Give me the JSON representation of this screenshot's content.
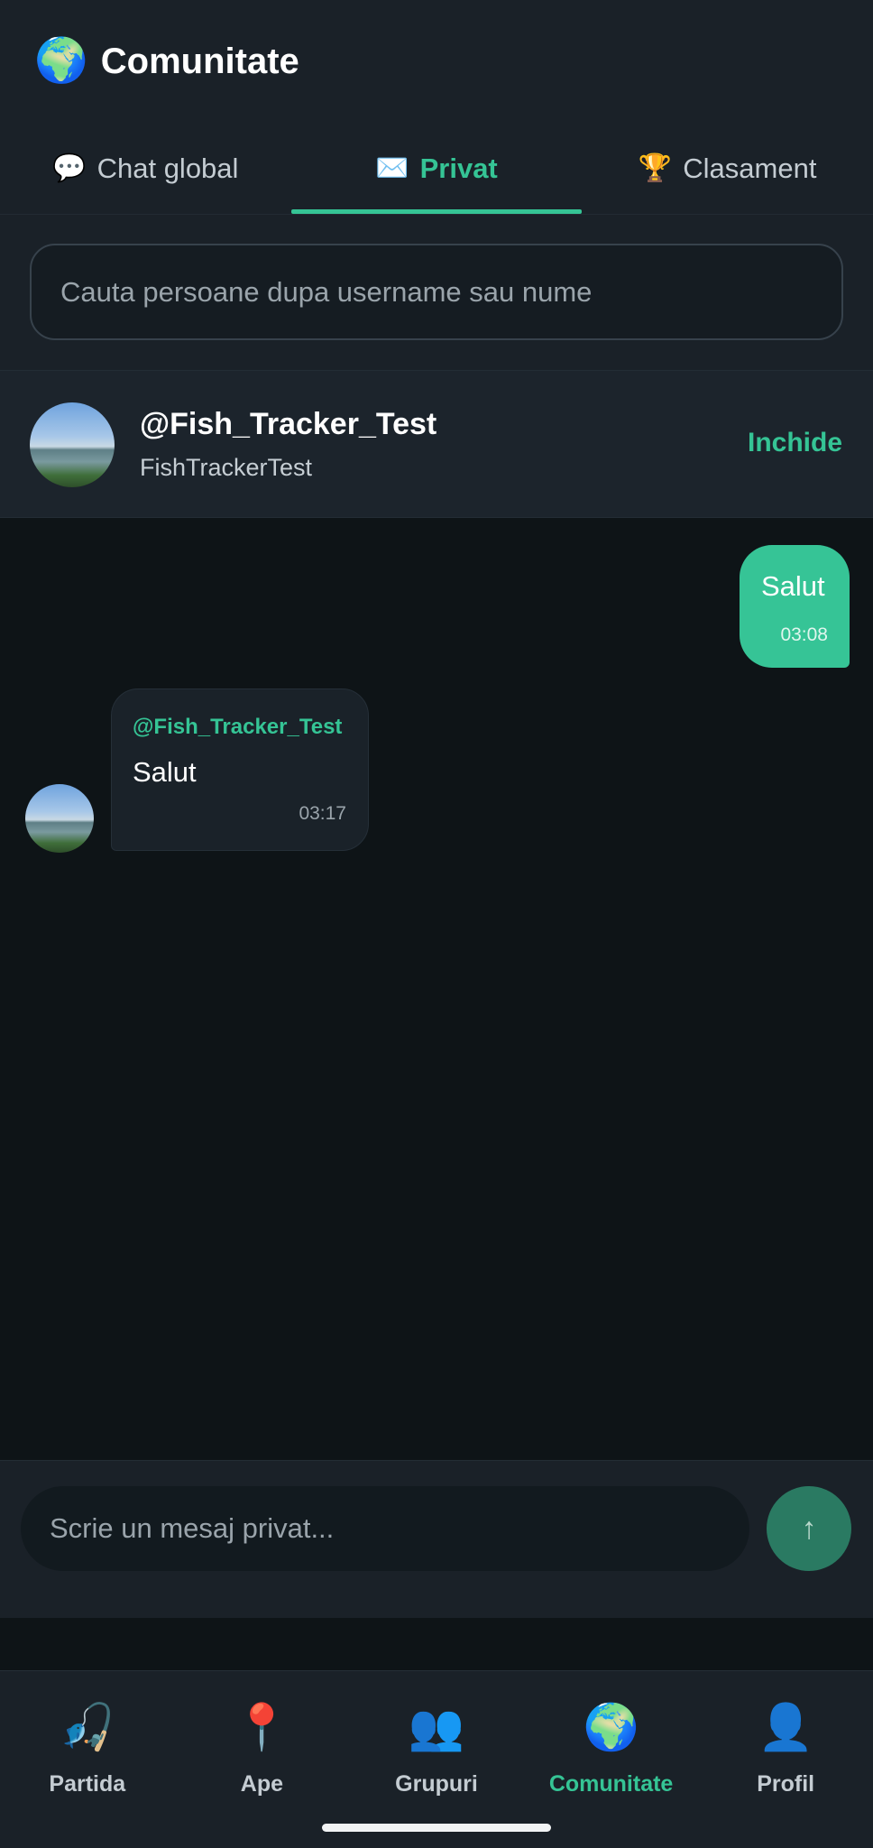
{
  "header": {
    "icon": "globe-icon",
    "title": "Comunitate"
  },
  "tabs": [
    {
      "icon": "speech-bubble-icon",
      "glyph": "💬",
      "label": "Chat global",
      "active": false
    },
    {
      "icon": "envelope-icon",
      "glyph": "✉️",
      "label": "Privat",
      "active": true
    },
    {
      "icon": "trophy-icon",
      "glyph": "🏆",
      "label": "Clasament",
      "active": false
    }
  ],
  "search": {
    "placeholder": "Cauta persoane dupa username sau nume",
    "value": ""
  },
  "chat_header": {
    "handle": "@Fish_Tracker_Test",
    "name": "FishTrackerTest",
    "close_label": "Inchide"
  },
  "messages": [
    {
      "direction": "out",
      "text": "Salut",
      "time": "03:08"
    },
    {
      "direction": "in",
      "sender": "@Fish_Tracker_Test",
      "text": "Salut",
      "time": "03:17"
    }
  ],
  "composer": {
    "placeholder": "Scrie un mesaj privat...",
    "value": "",
    "send_icon": "arrow-up-icon"
  },
  "bottom_nav": [
    {
      "icon": "fishing-rod-icon",
      "glyph": "🎣",
      "label": "Partida",
      "active": false
    },
    {
      "icon": "pin-icon",
      "glyph": "📍",
      "label": "Ape",
      "active": false
    },
    {
      "icon": "people-icon",
      "glyph": "👥",
      "label": "Grupuri",
      "active": false
    },
    {
      "icon": "globe-icon",
      "glyph": "🌍",
      "label": "Comunitate",
      "active": true
    },
    {
      "icon": "user-icon",
      "glyph": "👤",
      "label": "Profil",
      "active": false
    }
  ],
  "colors": {
    "accent": "#35c495",
    "background": "#0e1417",
    "surface": "#1a2128",
    "outgoing_bubble": "#36c496",
    "send_button": "#2a7a62"
  }
}
